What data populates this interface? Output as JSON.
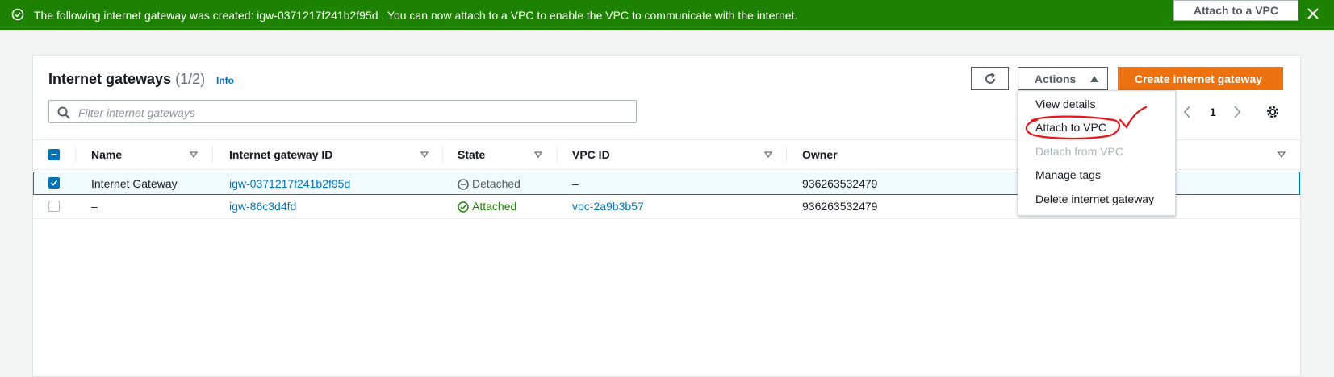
{
  "flash": {
    "message": "The following internet gateway was created: igw-0371217f241b2f95d . You can now attach to a VPC to enable the VPC to communicate with the internet.",
    "action_label": "Attach to a VPC",
    "color": "#1d8102"
  },
  "header": {
    "title": "Internet gateways",
    "count": "(1/2)",
    "info_label": "Info"
  },
  "toolbar": {
    "actions_label": "Actions",
    "create_label": "Create internet gateway",
    "refresh_icon": "refresh-icon"
  },
  "filter": {
    "placeholder": "Filter internet gateways",
    "value": ""
  },
  "pagination": {
    "current_page": "1"
  },
  "table": {
    "columns": [
      "Name",
      "Internet gateway ID",
      "State",
      "VPC ID",
      "Owner"
    ],
    "rows": [
      {
        "selected": true,
        "name": "Internet Gateway",
        "gateway_id": "igw-0371217f241b2f95d",
        "state": "Detached",
        "vpc_id": "–",
        "owner": "936263532479"
      },
      {
        "selected": false,
        "name": "–",
        "gateway_id": "igw-86c3d4fd",
        "state": "Attached",
        "vpc_id": "vpc-2a9b3b57",
        "owner": "936263532479"
      }
    ]
  },
  "actions_menu": {
    "items": [
      {
        "label": "View details",
        "disabled": false
      },
      {
        "label": "Attach to VPC",
        "disabled": false
      },
      {
        "label": "Detach from VPC",
        "disabled": true
      },
      {
        "label": "Manage tags",
        "disabled": false
      },
      {
        "label": "Delete internet gateway",
        "disabled": false
      }
    ]
  },
  "colors": {
    "primary": "#ec7211",
    "link": "#0073bb",
    "success": "#1d8102",
    "annotation": "#e8141b"
  }
}
